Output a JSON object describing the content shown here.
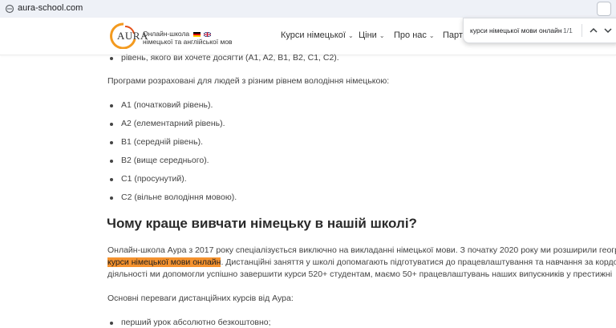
{
  "browser": {
    "url": "aura-school.com"
  },
  "header": {
    "logo_word": "AURA",
    "tagline_line1": "Онлайн-школа",
    "tagline_line2": "німецької та англійської мов",
    "nav": [
      {
        "label": "Курси німецької"
      },
      {
        "label": "Ціни"
      },
      {
        "label": "Про нас"
      },
      {
        "label": "Партн"
      }
    ]
  },
  "find": {
    "query": "курси німецької мови онлайн",
    "count": "1/1"
  },
  "content": {
    "partial_bullet": "рівень, якого ви хочете досягти (A1, A2, B1, B2, C1, C2).",
    "programs_intro": "Програми розраховані для людей з різним рівнем володіння німецькою:",
    "levels": [
      "A1 (початковий рівень).",
      "A2 (елементарний рівень).",
      "B1 (середній рівень).",
      "B2 (вище середнього).",
      "C1 (просунутий).",
      "C2 (вільне володіння мовою)."
    ],
    "heading": "Чому краще вивчати німецьку в нашій школі?",
    "para_line1": "Онлайн-школа Аура з 2017 року спеціалізується виключно на викладанні німецької мови. З початку 2020 року ми розширили геогр",
    "para_line2_highlight": "курси німецької мови онлайн",
    "para_line2_rest": ". Дистанційні заняття у школі допомагають підготуватися до працевлаштування та навчання за кордо",
    "para_line3": "діяльності ми допомогли успішно завершити курси 520+ студентам, маємо 50+ працевлаштувань наших випускників у престижні",
    "advantages_intro": "Основні переваги дистанційних курсів від Аура:",
    "advantages": [
      "перший урок абсолютно безкоштовно;"
    ]
  },
  "colors": {
    "highlight": "#f5922e",
    "logo_orange": "#f39a1f"
  }
}
